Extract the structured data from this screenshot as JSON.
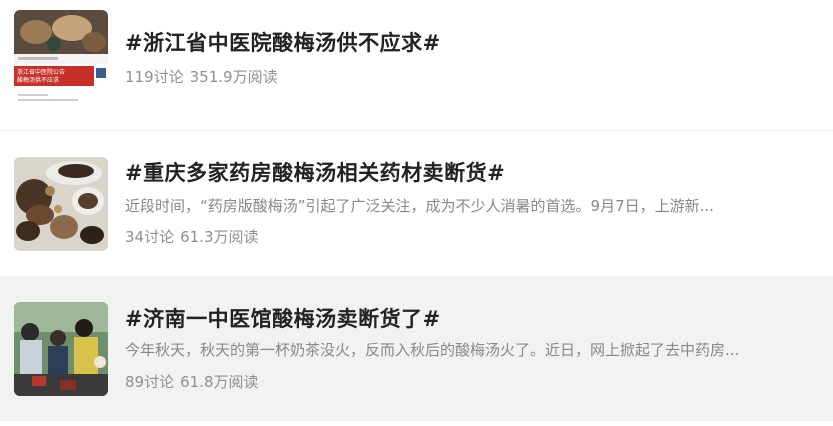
{
  "topics": [
    {
      "title": "#浙江省中医院酸梅汤供不应求#",
      "summary": "",
      "discussions": "119讨论",
      "reads": "351.9万阅读",
      "thumbnail": {
        "icon": "news-screenshot-thumbnail",
        "headline_lines": [
          "浙江省中医院公告",
          "酸梅汤供不应求"
        ]
      }
    },
    {
      "title": "#重庆多家药房酸梅汤相关药材卖断货#",
      "summary": "近段时间，“药房版酸梅汤”引起了广泛关注，成为不少人消暑的首选。9月7日，上游新...",
      "discussions": "34讨论",
      "reads": "61.3万阅读",
      "thumbnail": {
        "icon": "herbal-ingredients-thumbnail"
      }
    },
    {
      "title": "#济南一中医馆酸梅汤卖断货了#",
      "summary": "今年秋天，秋天的第一杯奶茶没火，反而入秋后的酸梅汤火了。近日，网上掀起了去中药房...",
      "discussions": "89讨论",
      "reads": "61.8万阅读",
      "thumbnail": {
        "icon": "crowd-photo-thumbnail"
      }
    }
  ],
  "colors": {
    "title": "#222222",
    "summary": "#888888",
    "stats": "#8f8f8f",
    "highlight_row": "#f2f2f2"
  }
}
